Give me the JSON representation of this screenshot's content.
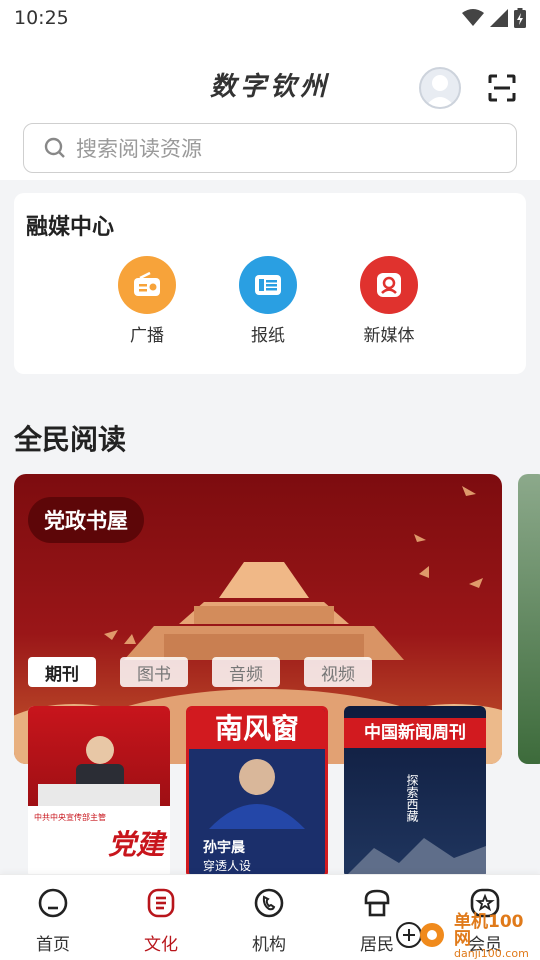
{
  "status_bar": {
    "time": "10:25"
  },
  "header": {
    "app_title": "数字钦州",
    "search_placeholder": "搜索阅读资源"
  },
  "media_center": {
    "title": "融媒中心",
    "items": [
      {
        "label": "广播",
        "icon": "radio-icon",
        "color": "#f7a33a"
      },
      {
        "label": "报纸",
        "icon": "newspaper-icon",
        "color": "#2a9fe2"
      },
      {
        "label": "新媒体",
        "icon": "new-media-icon",
        "color": "#e0322e"
      }
    ]
  },
  "reading": {
    "title": "全民阅读",
    "banner_badge": "党政书屋",
    "tabs": [
      "期刊",
      "图书",
      "音频",
      "视频"
    ],
    "active_tab": "期刊",
    "magazines": [
      {
        "title": "党建",
        "caption": "中共中央宣传部主管"
      },
      {
        "title": "南风窗",
        "caption_name": "孙宇晨",
        "caption_sub": "穿透人设"
      },
      {
        "title": "中国新闻周刊",
        "caption": "探索西藏"
      }
    ]
  },
  "bottom_nav": {
    "items": [
      {
        "label": "首页",
        "icon": "home-icon",
        "active": false
      },
      {
        "label": "文化",
        "icon": "culture-icon",
        "active": true
      },
      {
        "label": "机构",
        "icon": "institution-icon",
        "active": false
      },
      {
        "label": "居民",
        "icon": "resident-icon",
        "active": false
      },
      {
        "label": "会员",
        "icon": "member-icon",
        "active": false
      }
    ]
  },
  "watermark": {
    "brand": "单机100网",
    "url": "danji100.com"
  },
  "colors": {
    "accent": "#b8151b",
    "banner": "#8f1315"
  }
}
